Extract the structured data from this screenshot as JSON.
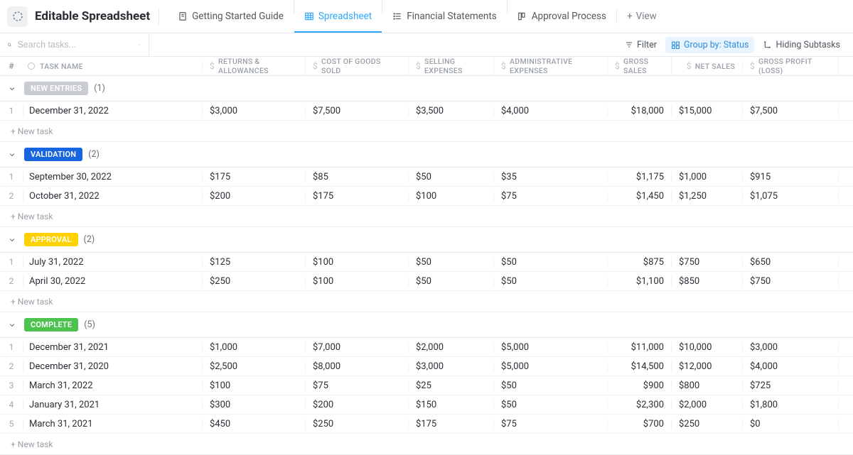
{
  "header": {
    "title": "Editable Spreadsheet",
    "tabs": [
      {
        "label": "Getting Started Guide",
        "icon": "doc"
      },
      {
        "label": "Spreadsheet",
        "icon": "table",
        "active": true
      },
      {
        "label": "Financial Statements",
        "icon": "list"
      },
      {
        "label": "Approval Process",
        "icon": "board"
      }
    ],
    "add_view": "View"
  },
  "subbar": {
    "search_placeholder": "Search tasks...",
    "filter": "Filter",
    "groupby": "Group by: Status",
    "hiding": "Hiding Subtasks"
  },
  "columns": {
    "num": "#",
    "task_name": "TASK NAME",
    "c1": "RETURNS & ALLOWANCES",
    "c2": "COST OF GOODS SOLD",
    "c3": "SELLING EXPENSES",
    "c4": "ADMINISTRATIVE EXPENSES",
    "c5": "GROSS SALES",
    "c6": "NET SALES",
    "c7": "GROSS PROFIT (LOSS)"
  },
  "new_task_label": "+ New task",
  "groups": [
    {
      "name": "NEW ENTRIES",
      "class": "gray",
      "count": "(1)",
      "rows": [
        {
          "n": "1",
          "name": "December 31, 2022",
          "c1": "$3,000",
          "c2": "$7,500",
          "c3": "$3,500",
          "c4": "$4,000",
          "c5": "$18,000",
          "c6": "$15,000",
          "c7": "$7,500"
        }
      ]
    },
    {
      "name": "VALIDATION",
      "class": "blue",
      "count": "(2)",
      "rows": [
        {
          "n": "1",
          "name": "September 30, 2022",
          "c1": "$175",
          "c2": "$85",
          "c3": "$50",
          "c4": "$35",
          "c5": "$1,175",
          "c6": "$1,000",
          "c7": "$915"
        },
        {
          "n": "2",
          "name": "October 31, 2022",
          "c1": "$200",
          "c2": "$175",
          "c3": "$100",
          "c4": "$75",
          "c5": "$1,450",
          "c6": "$1,250",
          "c7": "$1,075"
        }
      ]
    },
    {
      "name": "APPROVAL",
      "class": "yellow",
      "count": "(2)",
      "rows": [
        {
          "n": "1",
          "name": "July 31, 2022",
          "c1": "$125",
          "c2": "$100",
          "c3": "$50",
          "c4": "$50",
          "c5": "$875",
          "c6": "$750",
          "c7": "$650"
        },
        {
          "n": "2",
          "name": "April 30, 2022",
          "c1": "$250",
          "c2": "$100",
          "c3": "$50",
          "c4": "$50",
          "c5": "$1,100",
          "c6": "$850",
          "c7": "$750"
        }
      ]
    },
    {
      "name": "COMPLETE",
      "class": "green",
      "count": "(5)",
      "rows": [
        {
          "n": "1",
          "name": "December 31, 2021",
          "c1": "$1,000",
          "c2": "$7,000",
          "c3": "$2,000",
          "c4": "$5,000",
          "c5": "$11,000",
          "c6": "$10,000",
          "c7": "$3,000"
        },
        {
          "n": "2",
          "name": "December 31, 2020",
          "c1": "$2,500",
          "c2": "$8,000",
          "c3": "$3,000",
          "c4": "$5,000",
          "c5": "$14,500",
          "c6": "$12,000",
          "c7": "$4,000"
        },
        {
          "n": "3",
          "name": "March 31, 2022",
          "c1": "$100",
          "c2": "$75",
          "c3": "$25",
          "c4": "$50",
          "c5": "$900",
          "c6": "$800",
          "c7": "$725"
        },
        {
          "n": "4",
          "name": "January 31, 2021",
          "c1": "$300",
          "c2": "$200",
          "c3": "$150",
          "c4": "$50",
          "c5": "$2,300",
          "c6": "$2,000",
          "c7": "$1,800"
        },
        {
          "n": "5",
          "name": "March 31, 2021",
          "c1": "$450",
          "c2": "$250",
          "c3": "$175",
          "c4": "$75",
          "c5": "$700",
          "c6": "$250",
          "c7": "$0"
        }
      ]
    }
  ]
}
